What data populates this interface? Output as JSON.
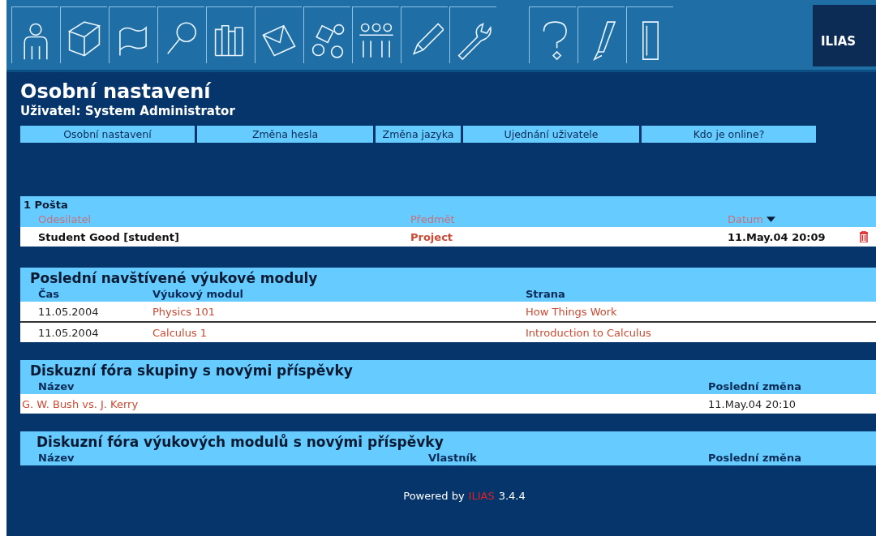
{
  "toolbar": {
    "logo": "ILIAS"
  },
  "header": {
    "title": "Osobní nastavení",
    "subtitle": "Uživatel: System Administrator"
  },
  "tabs": [
    {
      "label": "Osobní nastavení"
    },
    {
      "label": "Změna hesla"
    },
    {
      "label": "Změna jazyka"
    },
    {
      "label": "Ujednání uživatele"
    },
    {
      "label": "Kdo je online?"
    }
  ],
  "panels": [
    {
      "kind": "mail",
      "title": "1 Pošta",
      "columns": [
        {
          "label": "Odesilatel",
          "sortable": true,
          "sorted": false
        },
        {
          "label": "Předmět",
          "sortable": true,
          "sorted": false
        },
        {
          "label": "Datum",
          "sortable": true,
          "sorted": true
        }
      ],
      "rows": [
        {
          "cells": [
            {
              "text": "Student Good [student]",
              "kind": "bold"
            },
            {
              "text": "Project",
              "kind": "bold-link"
            },
            {
              "text": "11.May.04 20:09",
              "kind": "bold"
            }
          ],
          "deletable": true
        }
      ]
    },
    {
      "kind": "modules",
      "title": "Poslední navštívené výukové moduly",
      "columns": [
        {
          "label": "Čas",
          "sortable": false,
          "sorted": false
        },
        {
          "label": "Výukový modul",
          "sortable": false,
          "sorted": false
        },
        {
          "label": "Strana",
          "sortable": false,
          "sorted": false
        }
      ],
      "rows": [
        {
          "cells": [
            {
              "text": "11.05.2004",
              "kind": "text"
            },
            {
              "text": "Physics 101",
              "kind": "link"
            },
            {
              "text": "How Things Work",
              "kind": "link"
            }
          ],
          "deletable": false
        },
        {
          "cells": [
            {
              "text": "11.05.2004",
              "kind": "text"
            },
            {
              "text": "Calculus 1",
              "kind": "link"
            },
            {
              "text": "Introduction to Calculus",
              "kind": "link"
            }
          ],
          "deletable": false
        }
      ]
    },
    {
      "kind": "forums",
      "title": "Diskuzní fóra skupiny s novými příspěvky",
      "columns": [
        {
          "label": "Název",
          "sortable": false,
          "sorted": false
        },
        {
          "label": "Poslední změna",
          "sortable": false,
          "sorted": false
        }
      ],
      "rows": [
        {
          "cells": [
            {
              "text": "G. W. Bush vs. J. Kerry",
              "kind": "link"
            },
            {
              "text": "11.May.04 20:10",
              "kind": "text"
            }
          ],
          "deletable": false
        }
      ]
    },
    {
      "kind": "lm-forums",
      "title": "Diskuzní fóra výukových modulů s novými příspěvky",
      "columns": [
        {
          "label": "Název",
          "sortable": false,
          "sorted": false
        },
        {
          "label": "Vlastník",
          "sortable": false,
          "sorted": false
        },
        {
          "label": "Poslední změna",
          "sortable": false,
          "sorted": false
        }
      ]
    }
  ],
  "footer": {
    "prefix": "Powered by",
    "brand": "ILIAS",
    "version": "3.4.4"
  }
}
